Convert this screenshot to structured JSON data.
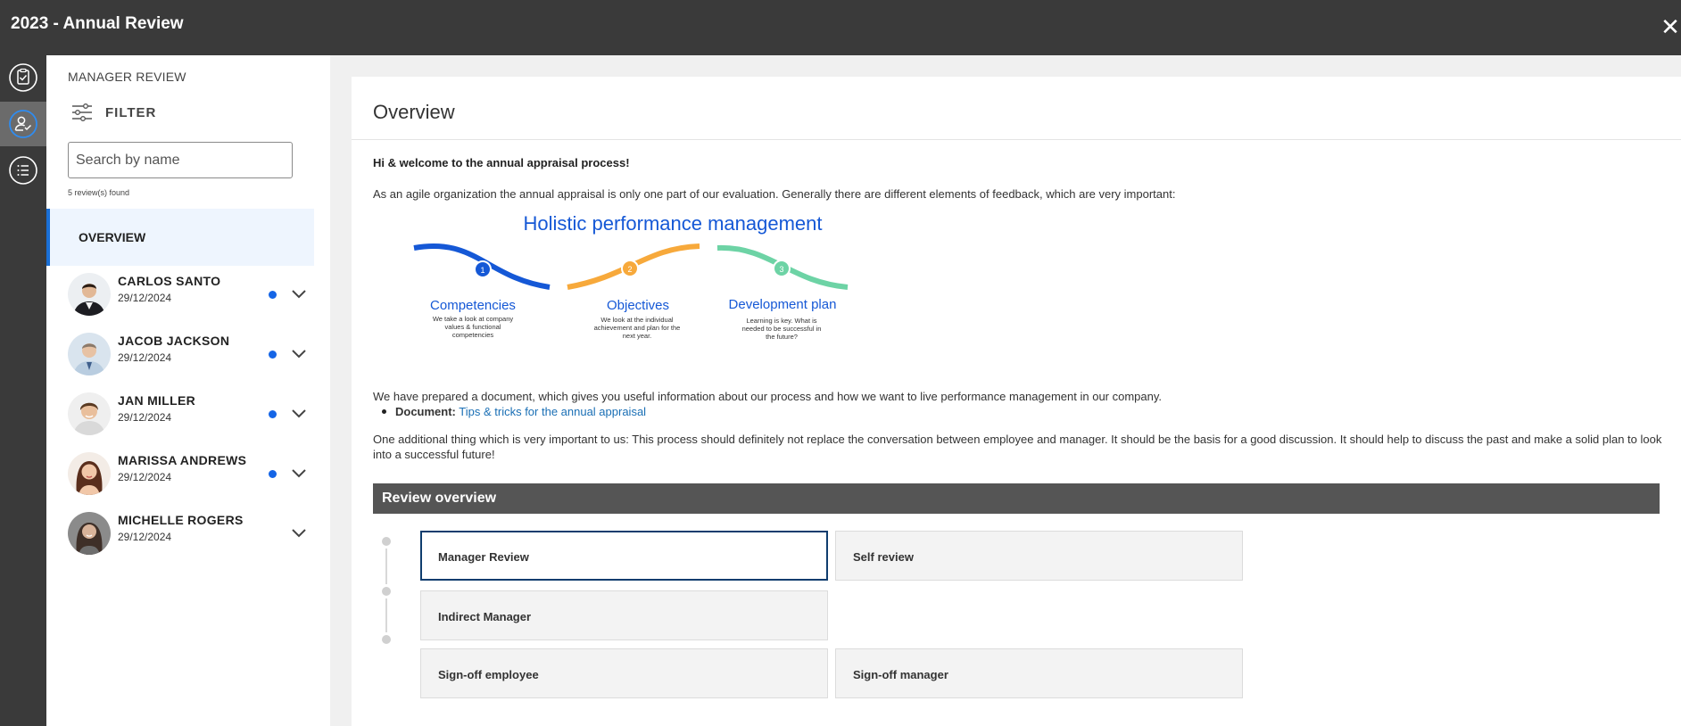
{
  "window": {
    "title": "2023 - Annual Review",
    "close_icon": "close-icon"
  },
  "rail": {
    "items": [
      {
        "icon": "clipboard-check-icon",
        "active": false
      },
      {
        "icon": "user-check-icon",
        "active": true
      },
      {
        "icon": "list-icon",
        "active": false
      }
    ]
  },
  "sidebar": {
    "heading": "MANAGER REVIEW",
    "filter_label": "FILTER",
    "search_placeholder": "Search by name",
    "found_text": "5 review(s) found",
    "overview_label": "OVERVIEW",
    "people": [
      {
        "name": "CARLOS SANTO",
        "date": "29/12/2024",
        "unread": true
      },
      {
        "name": "JACOB JACKSON",
        "date": "29/12/2024",
        "unread": true
      },
      {
        "name": "JAN MILLER",
        "date": "29/12/2024",
        "unread": true
      },
      {
        "name": "MARISSA ANDREWS",
        "date": "29/12/2024",
        "unread": true
      },
      {
        "name": "MICHELLE ROGERS",
        "date": "29/12/2024",
        "unread": false
      }
    ]
  },
  "main": {
    "title": "Overview",
    "welcome": "Hi & welcome to the annual appraisal process!",
    "intro": "As an agile organization the annual appraisal is only one part of our evaluation. Generally there are different elements of feedback, which are very important:",
    "infographic": {
      "title": "Holistic performance management",
      "steps": [
        {
          "num": "1",
          "title": "Competencies",
          "lines": [
            "We take a look at company",
            "values & functional",
            "competencies"
          ],
          "color": "#1558d6"
        },
        {
          "num": "2",
          "title": "Objectives",
          "lines": [
            "We look at the individual",
            "achievement and plan for the",
            "next year."
          ],
          "color": "#f7a93b"
        },
        {
          "num": "3",
          "title": "Development plan",
          "lines": [
            "Learning is key. What is",
            "needed to be successful in",
            "the future?"
          ],
          "color": "#6dd3a5"
        }
      ]
    },
    "prepared": "We have prepared a document, which gives you useful information about our process and how we want to live performance management in our company.",
    "document_label": "Document:",
    "document_link": "Tips & tricks for the annual appraisal",
    "additional": "One additional thing which is very important to us: This process should definitely not replace the conversation between employee and manager. It should be the basis for a good discussion. It should help to discuss the past and make a solid plan to look into a successful future!",
    "review_overview_title": "Review overview",
    "review_steps": {
      "manager_review": "Manager Review",
      "self_review": "Self review",
      "indirect_manager": "Indirect Manager",
      "signoff_employee": "Sign-off employee",
      "signoff_manager": "Sign-off manager"
    }
  }
}
